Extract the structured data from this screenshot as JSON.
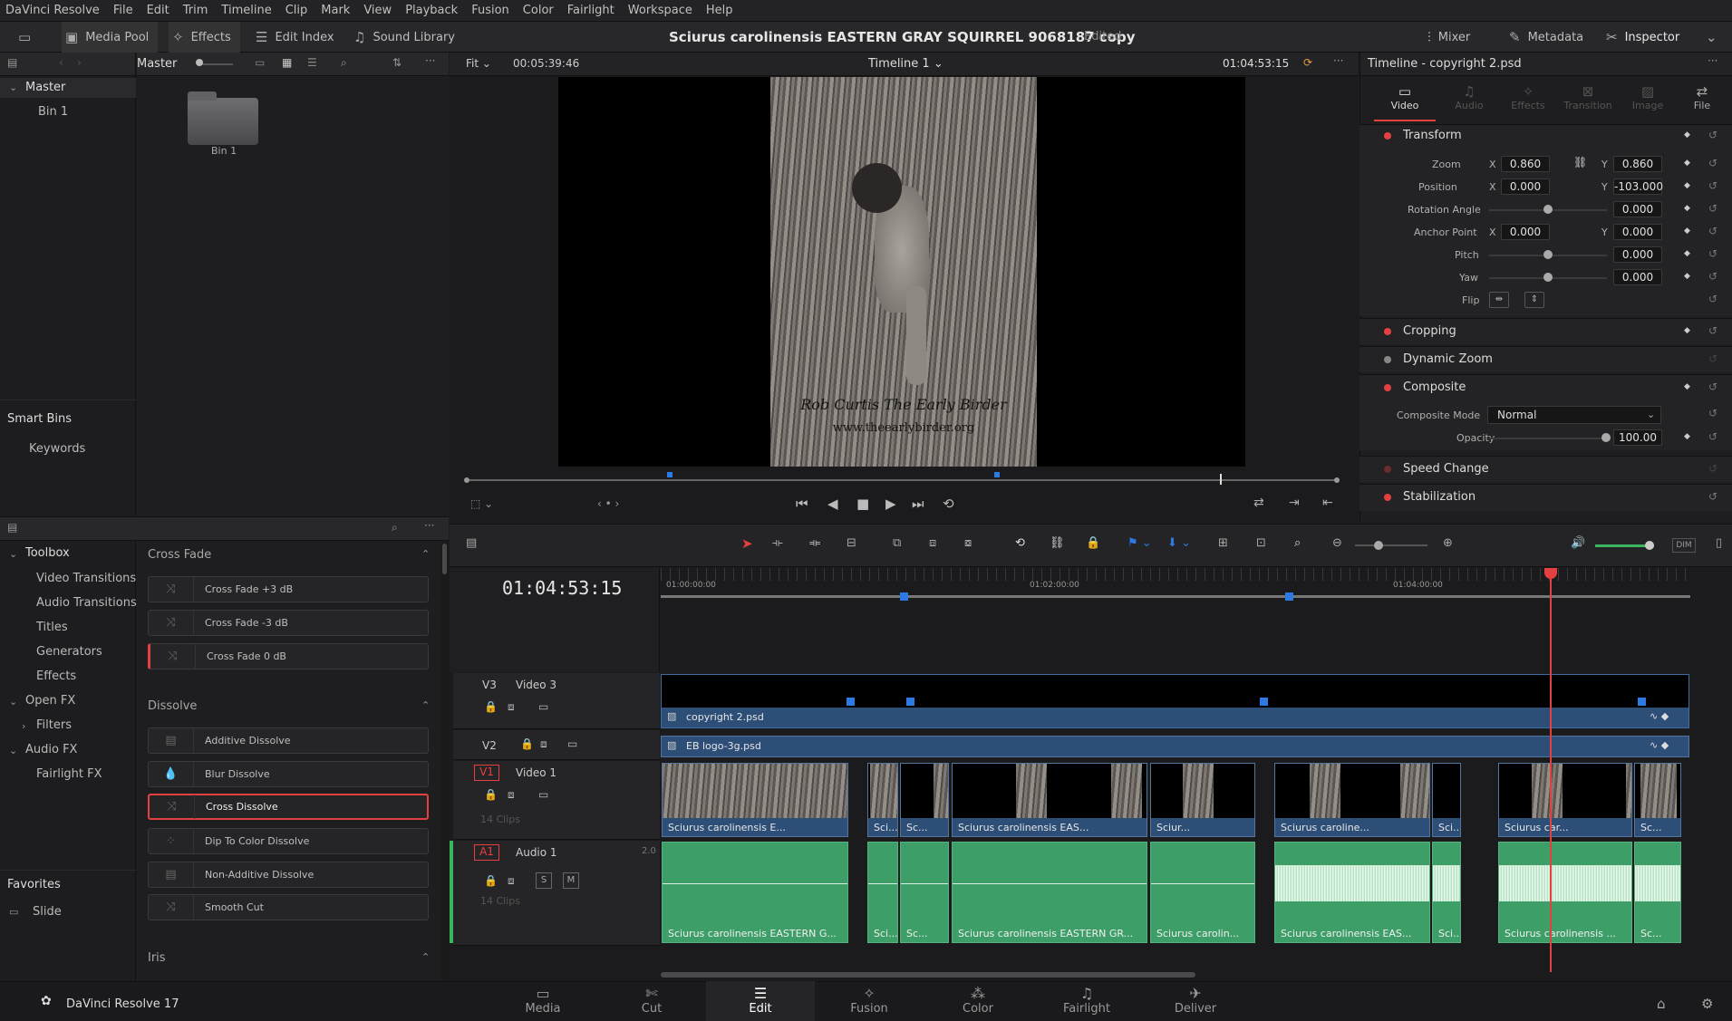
{
  "menu": [
    "DaVinci Resolve",
    "File",
    "Edit",
    "Trim",
    "Timeline",
    "Clip",
    "Mark",
    "View",
    "Playback",
    "Fusion",
    "Color",
    "Fairlight",
    "Workspace",
    "Help"
  ],
  "toolbar": {
    "media_pool": "Media Pool",
    "effects": "Effects",
    "edit_index": "Edit Index",
    "sound_library": "Sound Library",
    "title": "Sciurus carolinensis  EASTERN GRAY SQUIRREL 9068187 copy",
    "edited": "Edited",
    "mixer": "Mixer",
    "metadata": "Metadata",
    "inspector": "Inspector"
  },
  "media_pool": {
    "master": "Master",
    "bin": "Bin 1",
    "tree_master": "Master",
    "tree_bin": "Bin 1",
    "smart_bins": "Smart Bins",
    "keywords": "Keywords"
  },
  "viewer": {
    "fit": "Fit",
    "duration": "00:05:39:46",
    "timeline_name": "Timeline 1",
    "timecode": "01:04:53:15",
    "watermark1": "Rob Curtis The Early Birder",
    "watermark2": "www.theearlybirder.org"
  },
  "inspector": {
    "title": "Timeline - copyright 2.psd",
    "tabs": [
      "Video",
      "Audio",
      "Effects",
      "Transition",
      "Image",
      "File"
    ],
    "transform": "Transform",
    "zoom_label": "Zoom",
    "zoom_x": "0.860",
    "zoom_y": "0.860",
    "position_label": "Position",
    "pos_x": "0.000",
    "pos_y": "-103.000",
    "rotation_label": "Rotation Angle",
    "rotation": "0.000",
    "anchor_label": "Anchor Point",
    "anchor_x": "0.000",
    "anchor_y": "0.000",
    "pitch_label": "Pitch",
    "pitch": "0.000",
    "yaw_label": "Yaw",
    "yaw": "0.000",
    "flip_label": "Flip",
    "x": "X",
    "y": "Y",
    "cropping": "Cropping",
    "dynamic_zoom": "Dynamic Zoom",
    "composite": "Composite",
    "composite_mode_label": "Composite Mode",
    "composite_mode": "Normal",
    "opacity_label": "Opacity",
    "opacity": "100.00",
    "speed_change": "Speed Change",
    "stabilization": "Stabilization"
  },
  "effects_tree": {
    "toolbox": "Toolbox",
    "video_transitions": "Video Transitions",
    "audio_transitions": "Audio Transitions",
    "titles": "Titles",
    "generators": "Generators",
    "effects": "Effects",
    "open_fx": "Open FX",
    "filters": "Filters",
    "audio_fx": "Audio FX",
    "fairlight_fx": "Fairlight FX",
    "favorites": "Favorites",
    "slide": "Slide"
  },
  "effects_list": {
    "cross_fade": "Cross Fade",
    "cross_fade_items": [
      "Cross Fade +3 dB",
      "Cross Fade -3 dB",
      "Cross Fade 0 dB"
    ],
    "dissolve": "Dissolve",
    "dissolve_items": [
      "Additive Dissolve",
      "Blur Dissolve",
      "Cross Dissolve",
      "Dip To Color Dissolve",
      "Non-Additive Dissolve",
      "Smooth Cut"
    ],
    "iris": "Iris"
  },
  "timeline": {
    "timecode": "01:04:53:15",
    "ruler": [
      "01:00:00:00",
      "01:02:00:00",
      "01:04:00:00"
    ],
    "v3": "V3",
    "v3_name": "Video 3",
    "v2": "V2",
    "v1": "V1",
    "v1_name": "Video 1",
    "v1_clips": "14 Clips",
    "a1": "A1",
    "a1_name": "Audio 1",
    "a1_ch": "2.0",
    "a1_clips": "14 Clips",
    "s": "S",
    "m": "M",
    "v3_clip": "copyright 2.psd",
    "v2_clip": "EB logo-3g.psd",
    "video_clips": [
      "Sciurus carolinensis  E...",
      "Sci...",
      "Sc...",
      "Sciurus carolinensis  EAS...",
      "Sciur...",
      "Sciurus caroline...",
      "Sci...",
      "Sciurus car...",
      "Sc..."
    ],
    "audio_clips": [
      "Sciurus carolinensis  EASTERN G...",
      "Sci...",
      "Sc...",
      "Sciurus carolinensis  EASTERN GR...",
      "Sciurus carolin...",
      "Sciurus carolinensis  EAS...",
      "Sci...",
      "Sciurus carolinensis  ...",
      "Sc..."
    ]
  },
  "pages": [
    "Media",
    "Cut",
    "Edit",
    "Fusion",
    "Color",
    "Fairlight",
    "Deliver"
  ],
  "app_name": "DaVinci Resolve 17",
  "colors": {
    "accent": "#e54040",
    "video_clip": "#2d4f77",
    "audio_clip": "#3d9e68",
    "playhead": "#e54040"
  }
}
